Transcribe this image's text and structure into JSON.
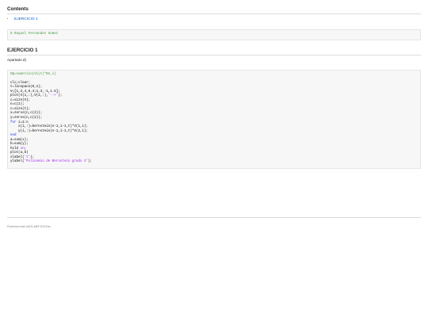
{
  "contents": {
    "title": "Contents",
    "items": [
      {
        "label": "EJERCICIO 1"
      }
    ]
  },
  "author_comment": "% Raquel Fernandez Gomez",
  "section": {
    "title": "EJERCICIO 1",
    "subtitle": "Apartado d)",
    "code_lines": [
      [
        {
          "t": "%Q=numerico(Vi(t)*Bn,i)",
          "c": "comment"
        }
      ],
      [],
      [
        {
          "t": "clc;clear;",
          "c": ""
        }
      ],
      [
        {
          "t": "t=linspace(0,1);",
          "c": ""
        }
      ],
      [
        {
          "t": "V=[1,2,4,6.4;1,3,-1,1.5];",
          "c": ""
        }
      ],
      [
        {
          "t": "plot(V(1,:),V(2,:),",
          "c": ""
        },
        {
          "t": "'--r'",
          "c": "string"
        },
        {
          "t": ");",
          "c": ""
        }
      ],
      [
        {
          "t": "c=size(V);",
          "c": ""
        }
      ],
      [
        {
          "t": "n=c(2);",
          "c": ""
        }
      ],
      [
        {
          "t": "c=size(t);",
          "c": ""
        }
      ],
      [
        {
          "t": "x=zeros(n,c(2));",
          "c": ""
        }
      ],
      [
        {
          "t": "y=zeros(n,c(2));",
          "c": ""
        }
      ],
      [
        {
          "t": "for",
          "c": "keyword"
        },
        {
          "t": " i=1:n",
          "c": ""
        }
      ],
      [
        {
          "t": "    x(i,:)=bernstein(n-1,i-1,t)*V(1,i);",
          "c": ""
        }
      ],
      [
        {
          "t": "    y(i,:)=bernstein(n-1,i-1,t)*V(2,i);",
          "c": ""
        }
      ],
      [
        {
          "t": "end",
          "c": "keyword"
        }
      ],
      [
        {
          "t": "a=sum(x);",
          "c": ""
        }
      ],
      [
        {
          "t": "b=sum(y);",
          "c": ""
        }
      ],
      [
        {
          "t": "hold ",
          "c": ""
        },
        {
          "t": "on",
          "c": "string"
        },
        {
          "t": ";",
          "c": ""
        }
      ],
      [
        {
          "t": "plot(a,b)",
          "c": ""
        }
      ],
      [
        {
          "t": "xlabel(",
          "c": ""
        },
        {
          "t": "'t'",
          "c": "string"
        },
        {
          "t": ");",
          "c": ""
        }
      ],
      [
        {
          "t": "ylabel(",
          "c": ""
        },
        {
          "t": "'Polinomio de Bernstein grado 3'",
          "c": "string"
        },
        {
          "t": ");",
          "c": ""
        }
      ]
    ]
  },
  "footer": {
    "text": "Published with MATLAB® R2019a"
  }
}
